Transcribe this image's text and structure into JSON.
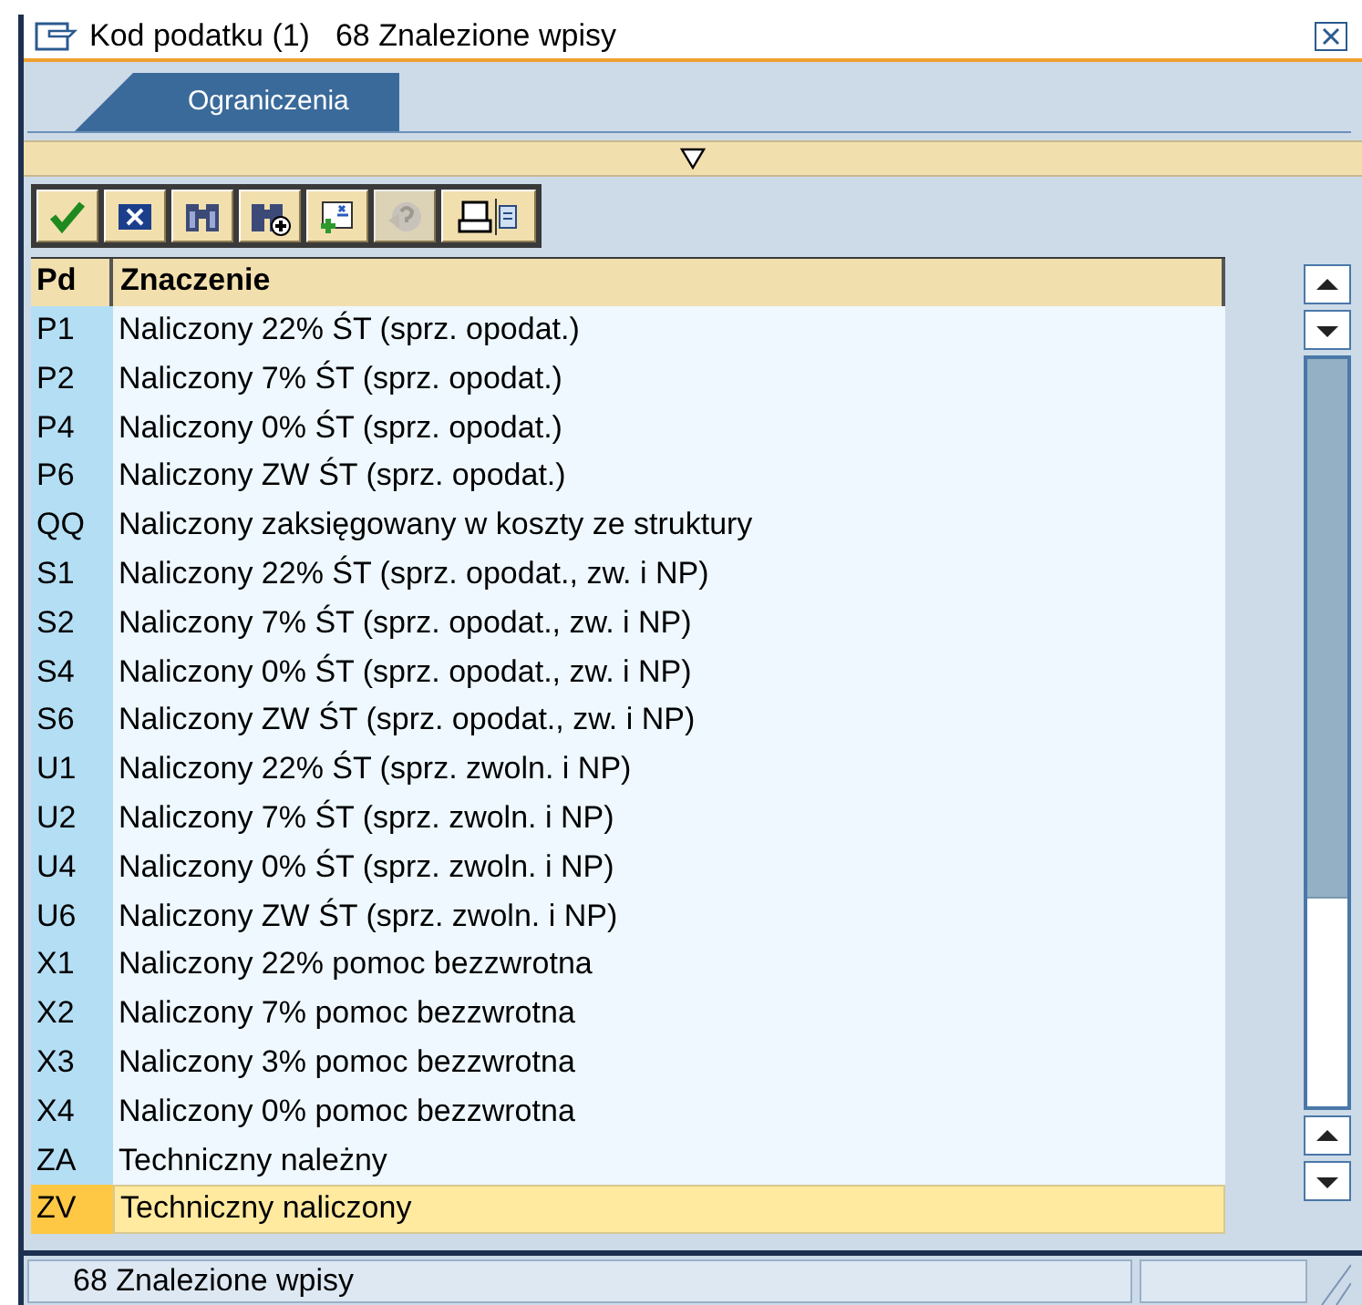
{
  "window": {
    "title": "Kod podatku (1)",
    "subtitle": "68 Znalezione wpisy"
  },
  "tabs": [
    {
      "label": "Ograniczenia",
      "selected": true
    }
  ],
  "toolbar": [
    {
      "kind": "check",
      "disabled": false
    },
    {
      "kind": "cancel",
      "disabled": false
    },
    {
      "kind": "find",
      "disabled": false
    },
    {
      "kind": "find-next",
      "disabled": false
    },
    {
      "kind": "insert",
      "disabled": false
    },
    {
      "kind": "help",
      "disabled": true
    },
    {
      "kind": "print",
      "disabled": false
    }
  ],
  "table": {
    "columns": [
      "Pd",
      "Znaczenie"
    ],
    "rows": [
      {
        "code": "P1",
        "text": "Naliczony 22% ŚT (sprz. opodat.)",
        "selected": false
      },
      {
        "code": "P2",
        "text": "Naliczony 7% ŚT (sprz. opodat.)",
        "selected": false
      },
      {
        "code": "P4",
        "text": "Naliczony 0% ŚT (sprz. opodat.)",
        "selected": false
      },
      {
        "code": "P6",
        "text": "Naliczony ZW ŚT (sprz. opodat.)",
        "selected": false
      },
      {
        "code": "QQ",
        "text": "Naliczony zaksięgowany w koszty ze struktury",
        "selected": false
      },
      {
        "code": "S1",
        "text": "Naliczony 22% ŚT (sprz. opodat., zw. i NP)",
        "selected": false
      },
      {
        "code": "S2",
        "text": "Naliczony 7% ŚT (sprz. opodat., zw. i NP)",
        "selected": false
      },
      {
        "code": "S4",
        "text": "Naliczony 0% ŚT (sprz. opodat., zw. i NP)",
        "selected": false
      },
      {
        "code": "S6",
        "text": "Naliczony ZW ŚT (sprz. opodat., zw. i NP)",
        "selected": false
      },
      {
        "code": "U1",
        "text": "Naliczony 22% ŚT (sprz. zwoln. i NP)",
        "selected": false
      },
      {
        "code": "U2",
        "text": "Naliczony 7% ŚT (sprz. zwoln. i NP)",
        "selected": false
      },
      {
        "code": "U4",
        "text": "Naliczony 0% ŚT (sprz. zwoln. i NP)",
        "selected": false
      },
      {
        "code": "U6",
        "text": "Naliczony ZW ŚT (sprz. zwoln. i NP)",
        "selected": false
      },
      {
        "code": "X1",
        "text": "Naliczony 22% pomoc bezzwrotna",
        "selected": false
      },
      {
        "code": "X2",
        "text": "Naliczony 7% pomoc bezzwrotna",
        "selected": false
      },
      {
        "code": "X3",
        "text": "Naliczony 3% pomoc bezzwrotna",
        "selected": false
      },
      {
        "code": "X4",
        "text": "Naliczony 0% pomoc bezzwrotna",
        "selected": false
      },
      {
        "code": "ZA",
        "text": "Techniczny należny",
        "selected": false
      },
      {
        "code": "ZV",
        "text": "Techniczny naliczony",
        "selected": true
      }
    ]
  },
  "status_bar": {
    "text": "68 Znalezione wpisy"
  }
}
